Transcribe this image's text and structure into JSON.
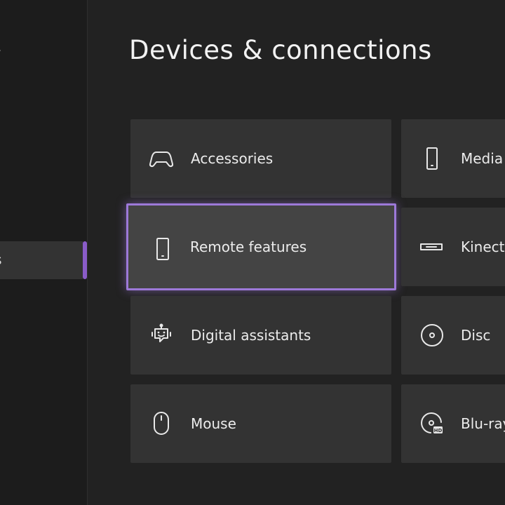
{
  "sidebar": {
    "items": [
      {
        "label": "y"
      },
      {
        "label": "ons"
      }
    ]
  },
  "page": {
    "title": "Devices & connections"
  },
  "tiles": [
    {
      "label": "Accessories",
      "icon": "gamepad-icon"
    },
    {
      "label": "Media",
      "icon": "phone-icon"
    },
    {
      "label": "Remote features",
      "icon": "phone-icon"
    },
    {
      "label": "Kinect",
      "icon": "kinect-icon"
    },
    {
      "label": "Digital assistants",
      "icon": "robot-icon"
    },
    {
      "label": "Disc",
      "icon": "disc-icon"
    },
    {
      "label": "Mouse",
      "icon": "mouse-icon"
    },
    {
      "label": "Blu-ray",
      "icon": "bluray-icon"
    }
  ],
  "colors": {
    "background": "#222222",
    "tile": "#333333",
    "focus_border": "#9d79d9",
    "accent": "#8a5cc8"
  }
}
